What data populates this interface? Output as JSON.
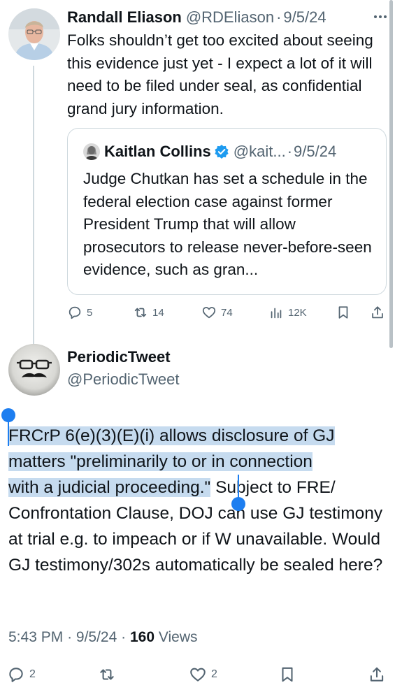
{
  "parent_tweet": {
    "author_name": "Randall Eliason",
    "handle": "@RDEliason",
    "separator": "·",
    "date": "9/5/24",
    "text": "Folks shouldn’t get too excited about seeing this evidence just yet - I expect a lot of it will need to be filed under seal, as confidential grand jury information.",
    "quote": {
      "author_name": "Kaitlan Collins",
      "handle": "@kait...",
      "separator": "·",
      "date": "9/5/24",
      "text": "Judge Chutkan has set a schedule in the federal election case against former President Trump that will allow prosecutors to release never-before-seen evidence, such as gran..."
    },
    "actions": {
      "replies": "5",
      "reposts": "14",
      "likes": "74",
      "views": "12K"
    }
  },
  "main_tweet": {
    "author_name": "PeriodicTweet",
    "handle": "@PeriodicTweet",
    "text_selected_1": "FRCrP 6(e)(3)(E)(i) allows disclosure of GJ",
    "text_selected_2": "matters \"preliminarily to or in connection",
    "text_selected_3": "with a judicial proceeding.\"",
    "text_rest": " Subject to FRE/ Confrontation Clause, DOJ can use GJ testimony at trial e.g. to impeach or if W unavailable. Would GJ testimony/302s automatically be sealed here?",
    "time": "5:43 PM",
    "separator": "·",
    "date": "9/5/24",
    "separator2": "·",
    "views_count": "160",
    "views_label": "Views",
    "actions": {
      "replies": "2",
      "likes": "2"
    }
  },
  "icons": [
    "more-icon",
    "verified-icon",
    "reply-icon",
    "repost-icon",
    "like-icon",
    "views-icon",
    "bookmark-icon",
    "share-icon"
  ],
  "colors": {
    "text": "#0f1419",
    "secondary": "#536471",
    "border": "#cfd9de",
    "verified": "#1d9bf0",
    "selection": "#c6dbef",
    "selection_handle": "#1d7ef0"
  }
}
